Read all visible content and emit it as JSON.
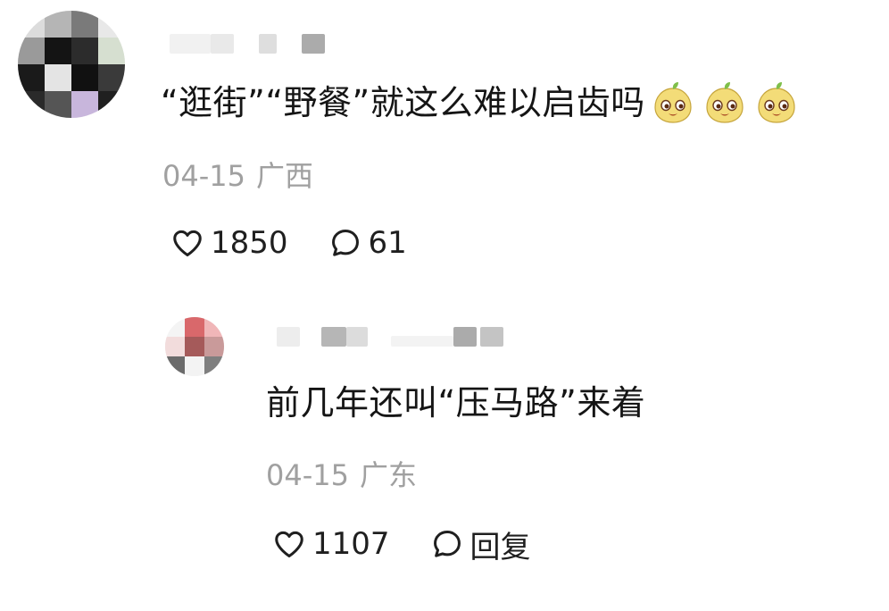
{
  "comments": [
    {
      "text": "“逛街”“野餐”就这么难以启齿吗",
      "emojis": [
        "mango-face-emoji",
        "mango-face-emoji",
        "mango-face-emoji"
      ],
      "date": "04-15",
      "region": "广西",
      "likes": "1850",
      "replies": "61"
    },
    {
      "text": "前几年还叫“压马路”来着",
      "date": "04-15",
      "region": "广东",
      "likes": "1107",
      "reply_label": "回复"
    }
  ],
  "icons": {
    "like": "heart-outline-icon",
    "comment": "speech-bubble-icon"
  },
  "colors": {
    "text": "#151515",
    "meta": "#a0a0a0",
    "background": "#ffffff",
    "emoji_fill": "#f3dc78",
    "emoji_leaf": "#7fbf4a"
  }
}
